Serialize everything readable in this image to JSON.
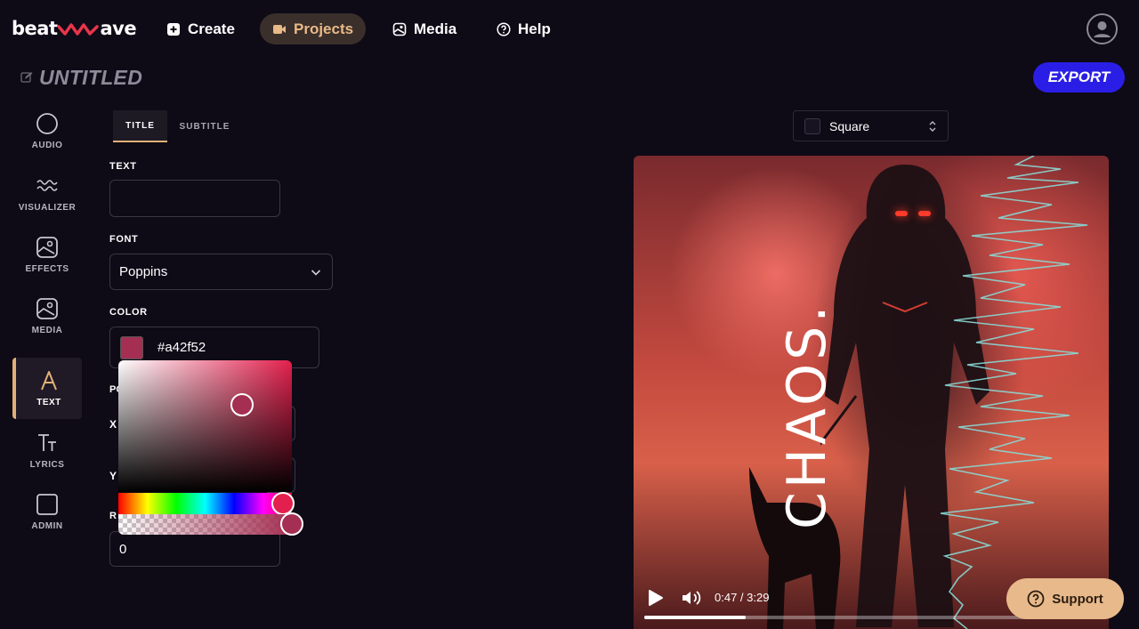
{
  "brand": {
    "logo_left": "beat",
    "logo_right": "ave"
  },
  "nav": [
    {
      "label": "Create",
      "icon": "plus-square-icon"
    },
    {
      "label": "Projects",
      "icon": "video-camera-icon",
      "active": true
    },
    {
      "label": "Media",
      "icon": "media-icon"
    },
    {
      "label": "Help",
      "icon": "help-circle-icon"
    }
  ],
  "project": {
    "title": "UNTITLED",
    "export_label": "EXPORT"
  },
  "sidebar": [
    {
      "label": "AUDIO",
      "icon": "circle-icon"
    },
    {
      "label": "VISUALIZER",
      "icon": "wave-icon"
    },
    {
      "label": "EFFECTS",
      "icon": "effects-icon"
    },
    {
      "label": "MEDIA",
      "icon": "media-icon"
    },
    {
      "label": "TEXT",
      "icon": "text-a-icon",
      "active": true
    },
    {
      "label": "LYRICS",
      "icon": "lyrics-icon"
    },
    {
      "label": "ADMIN",
      "icon": "square-icon"
    }
  ],
  "tabs": [
    {
      "label": "TITLE",
      "active": true
    },
    {
      "label": "SUBTITLE"
    }
  ],
  "form": {
    "text_label": "TEXT",
    "text_value": "",
    "font_label": "FONT",
    "font_value": "Poppins",
    "color_label": "COLOR",
    "color_value": "#a42f52",
    "position_label_partial": "PO",
    "x_label": "X",
    "y_label": "Y",
    "rotation_label_partial": "R",
    "rotation_value": "0"
  },
  "colors": {
    "selected": "#a42f52",
    "hue": "#e3204d",
    "accent": "#e2b077",
    "export": "#2a1ee6"
  },
  "preview": {
    "aspect_ratio": "Square",
    "overlay_text": "CHAOS.",
    "time": "0:47 / 3:29",
    "progress_fraction": 0.224
  },
  "support_label": "Support"
}
